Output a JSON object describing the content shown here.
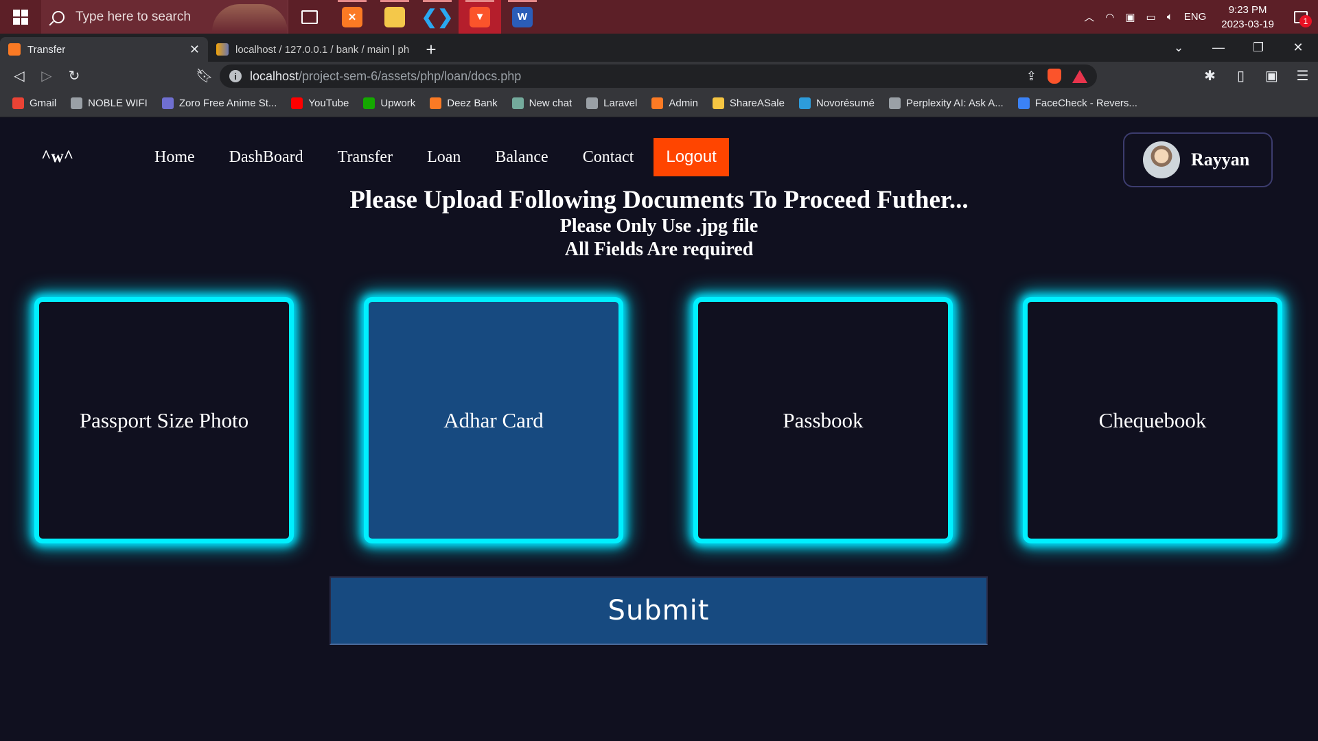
{
  "taskbar": {
    "search_placeholder": "Type here to search",
    "apps": [
      "task-view",
      "xampp",
      "file-explorer",
      "vscode",
      "brave",
      "word"
    ],
    "tray": {
      "language": "ENG",
      "time": "9:23 PM",
      "date": "2023-03-19",
      "notifications": "1"
    }
  },
  "browser": {
    "tabs": [
      {
        "title": "Transfer",
        "active": true
      },
      {
        "title": "localhost / 127.0.0.1 / bank / main | ph",
        "active": false
      }
    ],
    "url_host": "localhost",
    "url_path": "/project-sem-6/assets/php/loan/docs.php",
    "bookmarks": [
      {
        "label": "Gmail",
        "color": "#ea4335"
      },
      {
        "label": "NOBLE WIFI",
        "color": "#9aa0a6"
      },
      {
        "label": "Zoro Free Anime St...",
        "color": "#6f6fd0"
      },
      {
        "label": "YouTube",
        "color": "#ff0000"
      },
      {
        "label": "Upwork",
        "color": "#14a800"
      },
      {
        "label": "Deez Bank",
        "color": "#fb7a24"
      },
      {
        "label": "New chat",
        "color": "#74aa9c"
      },
      {
        "label": "Laravel",
        "color": "#9aa0a6"
      },
      {
        "label": "Admin",
        "color": "#fb7a24"
      },
      {
        "label": "ShareASale",
        "color": "#f5c542"
      },
      {
        "label": "Novorésumé",
        "color": "#2d9cdb"
      },
      {
        "label": "Perplexity AI: Ask A...",
        "color": "#9aa0a6"
      },
      {
        "label": "FaceCheck - Revers...",
        "color": "#3b82f6"
      }
    ]
  },
  "site": {
    "logo": "^w^",
    "nav": [
      "Home",
      "DashBoard",
      "Transfer",
      "Loan",
      "Balance",
      "Contact"
    ],
    "logout_label": "Logout",
    "user_name": "Rayyan",
    "accent_color": "#00f0ff",
    "logout_color": "#ff4500"
  },
  "main": {
    "title": "Please Upload Following Documents To Proceed Futher...",
    "subtitle1": "Please Only Use .jpg file",
    "subtitle2": "All Fields Are required",
    "cards": [
      "Passport Size Photo",
      "Adhar Card",
      "Passbook",
      "Chequebook"
    ],
    "submit_label": "Submit"
  }
}
